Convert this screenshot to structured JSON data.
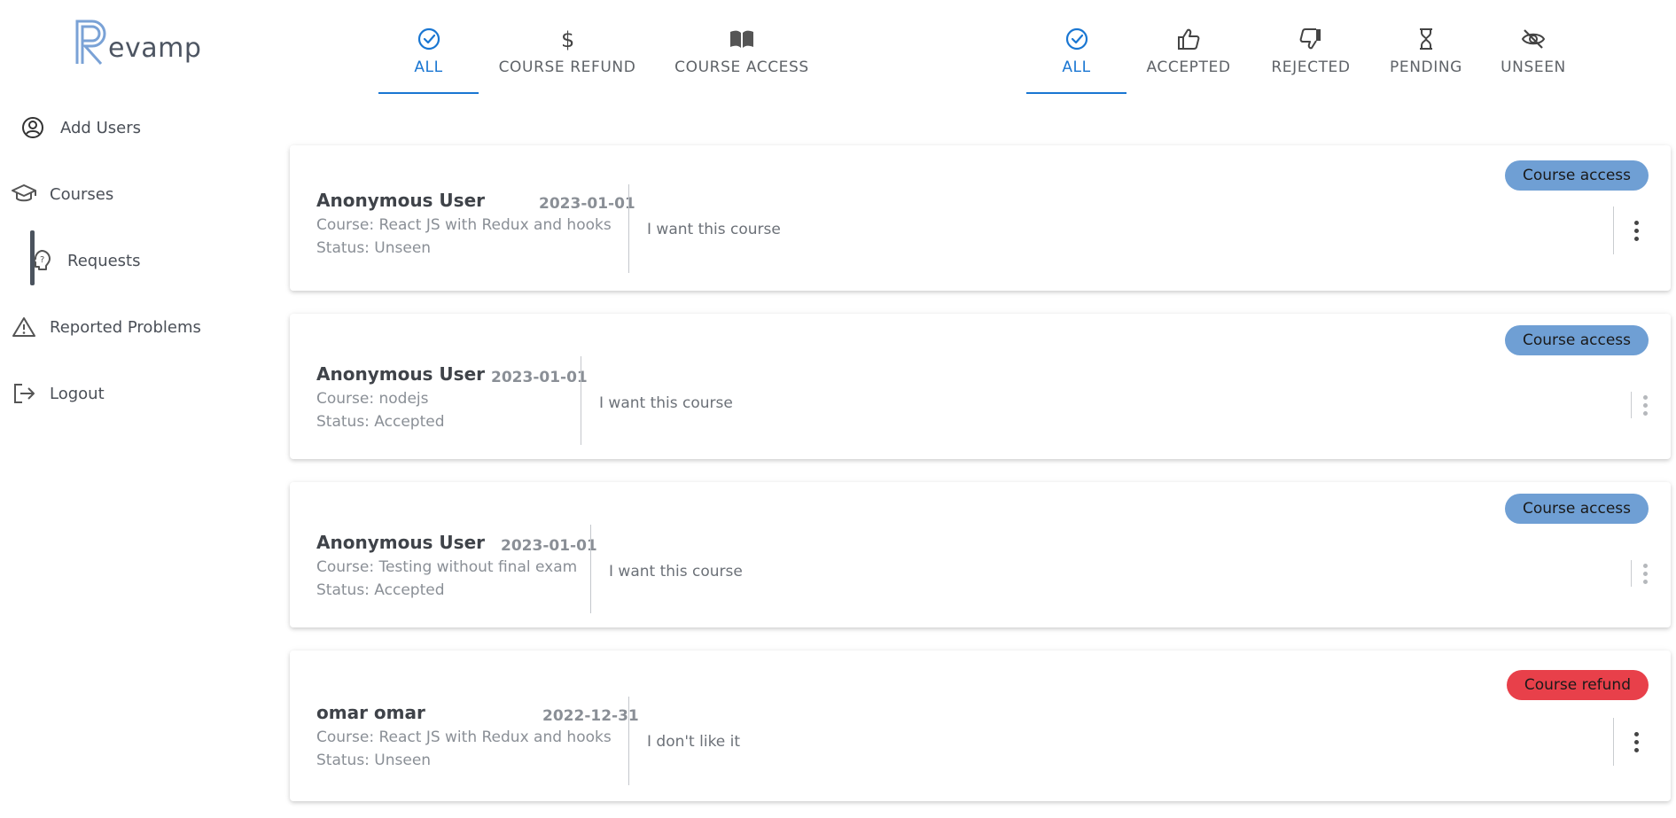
{
  "app": {
    "logo_text": "evamp"
  },
  "sidebar": {
    "items": [
      {
        "label": "Add Users",
        "icon": "user-circle-icon"
      },
      {
        "label": "Courses",
        "icon": "graduation-cap-icon"
      },
      {
        "label": "Requests",
        "icon": "question-bubble-icon",
        "active": true
      },
      {
        "label": "Reported Problems",
        "icon": "warning-icon"
      },
      {
        "label": "Logout",
        "icon": "logout-icon"
      }
    ]
  },
  "type_tabs": [
    {
      "label": "ALL",
      "icon": "check-circle-icon",
      "active": true
    },
    {
      "label": "COURSE REFUND",
      "icon": "dollar-icon"
    },
    {
      "label": "COURSE ACCESS",
      "icon": "book-icon"
    }
  ],
  "status_tabs": [
    {
      "label": "ALL",
      "icon": "check-circle-icon",
      "active": true
    },
    {
      "label": "ACCEPTED",
      "icon": "thumbs-up-icon"
    },
    {
      "label": "REJECTED",
      "icon": "thumbs-down-icon"
    },
    {
      "label": "PENDING",
      "icon": "hourglass-icon"
    },
    {
      "label": "UNSEEN",
      "icon": "eye-off-icon"
    }
  ],
  "requests": [
    {
      "name": "Anonymous User",
      "date": "2023-01-01",
      "course": "Course: React JS with Redux and hooks",
      "status": "Status: Unseen",
      "message": "I want this course",
      "badge": "Course access",
      "badge_color": "#6f9fd4",
      "menu_enabled": true
    },
    {
      "name": "Anonymous User",
      "date": "2023-01-01",
      "course": "Course: nodejs",
      "status": "Status: Accepted",
      "message": "I want this course",
      "badge": "Course access",
      "badge_color": "#6f9fd4",
      "menu_enabled": false
    },
    {
      "name": "Anonymous User",
      "date": "2023-01-01",
      "course": "Course: Testing without final exam",
      "status": "Status: Accepted",
      "message": "I want this course",
      "badge": "Course access",
      "badge_color": "#6f9fd4",
      "menu_enabled": false
    },
    {
      "name": "omar omar",
      "date": "2022-12-31",
      "course": "Course: React JS with Redux and hooks",
      "status": "Status: Unseen",
      "message": "I don't like it",
      "badge": "Course refund",
      "badge_color": "#e8404a",
      "menu_enabled": true
    }
  ],
  "colors": {
    "accent": "#1976d2",
    "access_badge": "#6f9fd4",
    "refund_badge": "#e8404a"
  }
}
